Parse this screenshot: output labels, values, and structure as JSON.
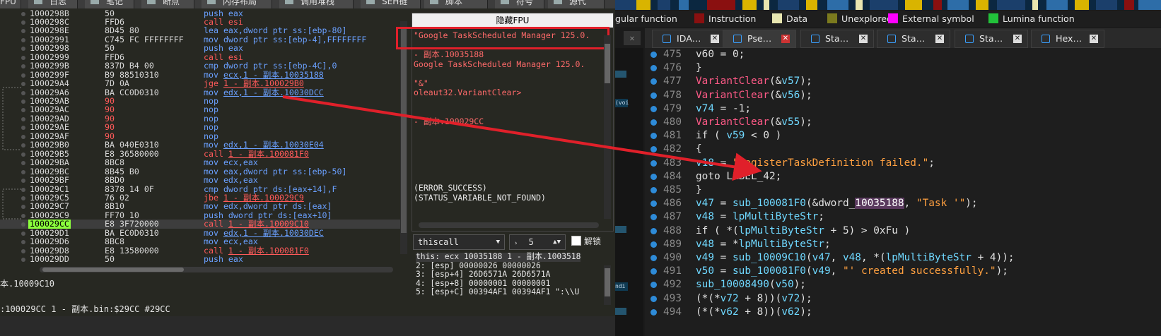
{
  "colors": {
    "accent_red": "#e0202a",
    "legend_instruction": "#8a1010",
    "legend_data": "#e8e6b0",
    "legend_unexplored": "#7b7a1e",
    "legend_external": "#ff00ff",
    "legend_lumina": "#22c23a"
  },
  "debugger": {
    "tabs": [
      {
        "label": "FPU",
        "icon": "cpu-icon"
      },
      {
        "label": "日志",
        "icon": "log-icon"
      },
      {
        "label": "笔记",
        "icon": "notes-icon"
      },
      {
        "label": "断点",
        "icon": "breakpoint-icon"
      },
      {
        "label": "内存布局",
        "icon": "memory-icon"
      },
      {
        "label": "调用堆栈",
        "icon": "callstack-icon"
      },
      {
        "label": "SEH链",
        "icon": "seh-icon"
      },
      {
        "label": "脚本",
        "icon": "script-icon"
      },
      {
        "label": "符号",
        "icon": "symbol-icon"
      },
      {
        "label": "源代",
        "icon": "source-icon"
      }
    ],
    "disasm": [
      {
        "addr": "1000298B",
        "bytes": "50",
        "mn": "push",
        "cls": "c-push",
        "ops": "eax"
      },
      {
        "addr": "1000298C",
        "bytes": "FFD6",
        "mn": "call",
        "cls": "c-call",
        "ops": "esi"
      },
      {
        "addr": "1000298E",
        "bytes": "8D45 80",
        "mn": "lea",
        "cls": "c-lea",
        "ops": "eax,dword ptr ss:[ebp-80]"
      },
      {
        "addr": "10002991",
        "bytes": "C745 FC FFFFFFFF",
        "mn": "mov",
        "cls": "c-mov",
        "ops": "dword ptr ss:[ebp-4],FFFFFFFF"
      },
      {
        "addr": "10002998",
        "bytes": "50",
        "mn": "push",
        "cls": "c-push",
        "ops": "eax"
      },
      {
        "addr": "10002999",
        "bytes": "FFD6",
        "mn": "call",
        "cls": "c-call",
        "ops": "esi"
      },
      {
        "addr": "1000299B",
        "bytes": "837D B4 00",
        "mn": "cmp",
        "cls": "c-cmp",
        "ops": "dword ptr ss:[ebp-4C],0"
      },
      {
        "addr": "1000299F",
        "bytes": "B9 88510310",
        "mn": "mov",
        "cls": "c-mov",
        "ops": "ecx,1 - 副本.10035188"
      },
      {
        "addr": "100029A4",
        "bytes": "7D 0A",
        "mn": "jge",
        "cls": "c-jmp",
        "ops": "1 - 副本.100029B0"
      },
      {
        "addr": "100029A6",
        "bytes": "BA CC0D0310",
        "mn": "mov",
        "cls": "c-mov",
        "ops": "edx,1 - 副本.10030DCC"
      },
      {
        "addr": "100029AB",
        "bytes": "90",
        "mn": "nop",
        "cls": "c-nop",
        "ops": "",
        "b": "nop"
      },
      {
        "addr": "100029AC",
        "bytes": "90",
        "mn": "nop",
        "cls": "c-nop",
        "ops": "",
        "b": "nop"
      },
      {
        "addr": "100029AD",
        "bytes": "90",
        "mn": "nop",
        "cls": "c-nop",
        "ops": "",
        "b": "nop"
      },
      {
        "addr": "100029AE",
        "bytes": "90",
        "mn": "nop",
        "cls": "c-nop",
        "ops": "",
        "b": "nop"
      },
      {
        "addr": "100029AF",
        "bytes": "90",
        "mn": "nop",
        "cls": "c-nop",
        "ops": "",
        "b": "nop"
      },
      {
        "addr": "100029B0",
        "bytes": "BA 040E0310",
        "mn": "mov",
        "cls": "c-mov",
        "ops": "edx,1 - 副本.10030E04"
      },
      {
        "addr": "100029B5",
        "bytes": "E8 36580000",
        "mn": "call",
        "cls": "c-call",
        "ops": "1 - 副本.100081F0"
      },
      {
        "addr": "100029BA",
        "bytes": "8BC8",
        "mn": "mov",
        "cls": "c-mov",
        "ops": "ecx,eax"
      },
      {
        "addr": "100029BC",
        "bytes": "8B45 B0",
        "mn": "mov",
        "cls": "c-mov",
        "ops": "eax,dword ptr ss:[ebp-50]"
      },
      {
        "addr": "100029BF",
        "bytes": "8BD0",
        "mn": "mov",
        "cls": "c-mov",
        "ops": "edx,eax"
      },
      {
        "addr": "100029C1",
        "bytes": "8378 14 0F",
        "mn": "cmp",
        "cls": "c-cmp",
        "ops": "dword ptr ds:[eax+14],F"
      },
      {
        "addr": "100029C5",
        "bytes": "76 02",
        "mn": "jbe",
        "cls": "c-jmp",
        "ops": "1 - 副本.100029C9"
      },
      {
        "addr": "100029C7",
        "bytes": "8B10",
        "mn": "mov",
        "cls": "c-mov",
        "ops": "edx,dword ptr ds:[eax]"
      },
      {
        "addr": "100029C9",
        "bytes": "FF70 10",
        "mn": "push",
        "cls": "c-push",
        "ops": "dword ptr ds:[eax+10]"
      },
      {
        "addr": "100029CC",
        "bytes": "E8 3F720000",
        "mn": "call",
        "cls": "c-call",
        "ops": "1 - 副本.10009C10",
        "cur": true
      },
      {
        "addr": "100029D1",
        "bytes": "BA EC0D0310",
        "mn": "mov",
        "cls": "c-mov",
        "ops": "edx,1 - 副本.10030DEC"
      },
      {
        "addr": "100029D6",
        "bytes": "8BC8",
        "mn": "mov",
        "cls": "c-mov",
        "ops": "ecx,eax"
      },
      {
        "addr": "100029D8",
        "bytes": "E8 13580000",
        "mn": "call",
        "cls": "c-call",
        "ops": "1 - 副本.100081F0"
      },
      {
        "addr": "100029DD",
        "bytes": "50",
        "mn": "push",
        "cls": "c-push",
        "ops": "eax"
      }
    ],
    "status_line1": "本.10009C10",
    "status_line2": ":100029CC 1 - 副本.bin:$29CC #29CC",
    "fpu_title": "隐藏FPU",
    "reg_lines": [
      {
        "t": "\"Google TaskScheduled Manager 125.0.",
        "c": "r"
      },
      {
        "t": "",
        "c": "r"
      },
      {
        "t": " - 副本.10035188",
        "c": "r"
      },
      {
        "t": "Google TaskScheduled Manager 125.0.",
        "c": "r"
      },
      {
        "t": "",
        "c": "r"
      },
      {
        "t": "\"&\"",
        "c": "r"
      },
      {
        "t": "oleaut32.VariantClear>",
        "c": "r"
      },
      {
        "t": "",
        "c": "r"
      },
      {
        "t": "",
        "c": "r"
      },
      {
        "t": " - 副本.100029CC",
        "c": "r"
      },
      {
        "t": "",
        "c": "r"
      },
      {
        "t": "",
        "c": "r"
      },
      {
        "t": "",
        "c": "r"
      },
      {
        "t": "",
        "c": "r"
      },
      {
        "t": "",
        "c": "r"
      },
      {
        "t": "",
        "c": "r"
      },
      {
        "t": "(ERROR_SUCCESS)",
        "c": "w"
      },
      {
        "t": "(STATUS_VARIABLE_NOT_FOUND)",
        "c": "w"
      }
    ],
    "callconv": "thiscall",
    "argcount": "5",
    "unlock_label": "解锁",
    "stack_lines": [
      "this: ecx 10035188 1 - 副本.1003518",
      "2: [esp] 00000026 00000026",
      "3: [esp+4] 26D6571A 26D6571A",
      "4: [esp+8] 00000001 00000001",
      "5: [esp+C] 00394AF1 00394AF1 \":\\\\U"
    ]
  },
  "ida": {
    "legend": [
      {
        "label": "gular function",
        "swatch": ""
      },
      {
        "label": "Instruction",
        "swatch": "#8a1010"
      },
      {
        "label": "Data",
        "swatch": "#e8e6b0"
      },
      {
        "label": "Unexplored",
        "swatch": "#7b7a1e"
      },
      {
        "label": "External symbol",
        "swatch": "#ff00ff"
      },
      {
        "label": "Lumina function",
        "swatch": "#22c23a"
      }
    ],
    "tabs": [
      {
        "label": "IDA…",
        "close": "light"
      },
      {
        "label": "Pse…",
        "close": "red",
        "active": true
      },
      {
        "label": "Sta…",
        "close": "light"
      },
      {
        "label": "Sta…",
        "close": "light"
      },
      {
        "label": "Sta…",
        "close": "light"
      },
      {
        "label": "Hex…",
        "close": "light"
      }
    ],
    "strip_chips": [
      "(voi",
      "ndi"
    ],
    "lines": [
      {
        "n": "475",
        "s": [
          [
            "  v60 = 0;",
            ""
          ]
        ]
      },
      {
        "n": "476",
        "s": [
          [
            "}",
            ""
          ]
        ]
      },
      {
        "n": "477",
        "s": [
          [
            "VariantClear",
            "k-fn"
          ],
          [
            "(&",
            ""
          ],
          [
            "v57",
            "k-var"
          ],
          [
            ");",
            ""
          ]
        ]
      },
      {
        "n": "478",
        "s": [
          [
            "VariantClear",
            "k-fn"
          ],
          [
            "(&",
            ""
          ],
          [
            "v56",
            "k-var"
          ],
          [
            ");",
            ""
          ]
        ]
      },
      {
        "n": "479",
        "s": [
          [
            "v74",
            "k-var"
          ],
          [
            " = -1;",
            ""
          ]
        ]
      },
      {
        "n": "480",
        "s": [
          [
            "VariantClear",
            "k-fn"
          ],
          [
            "(&",
            ""
          ],
          [
            "v55",
            "k-var"
          ],
          [
            ");",
            ""
          ]
        ]
      },
      {
        "n": "481",
        "s": [
          [
            "if ( ",
            ""
          ],
          [
            "v59",
            "k-var"
          ],
          [
            " < 0 )",
            ""
          ]
        ]
      },
      {
        "n": "482",
        "s": [
          [
            "{",
            ""
          ]
        ]
      },
      {
        "n": "483",
        "s": [
          [
            "  v18",
            "k-var"
          ],
          [
            " = ",
            ""
          ],
          [
            "\"RegisterTaskDefinition failed.\"",
            "k-str"
          ],
          [
            ";",
            ""
          ]
        ]
      },
      {
        "n": "484",
        "s": [
          [
            "  goto LABEL_42;",
            ""
          ]
        ]
      },
      {
        "n": "485",
        "s": [
          [
            "}",
            ""
          ]
        ]
      },
      {
        "n": "486",
        "s": [
          [
            "v47",
            "k-var"
          ],
          [
            " = ",
            ""
          ],
          [
            "sub_100081F0",
            "k-var"
          ],
          [
            "(&dword_",
            ""
          ],
          [
            "10035188",
            "k-hl"
          ],
          [
            ", ",
            ""
          ],
          [
            "\"Task '\"",
            "k-str"
          ],
          [
            ");",
            ""
          ]
        ]
      },
      {
        "n": "487",
        "s": [
          [
            "v48",
            "k-var"
          ],
          [
            " = ",
            ""
          ],
          [
            "lpMultiByteStr",
            "k-var"
          ],
          [
            ";",
            ""
          ]
        ]
      },
      {
        "n": "488",
        "s": [
          [
            "if ( *(",
            ""
          ],
          [
            "lpMultiByteStr",
            "k-var"
          ],
          [
            " + 5) > 0xFu )",
            ""
          ]
        ]
      },
      {
        "n": "489",
        "s": [
          [
            "  v48",
            "k-var"
          ],
          [
            " = *",
            ""
          ],
          [
            "lpMultiByteStr",
            "k-var"
          ],
          [
            ";",
            ""
          ]
        ]
      },
      {
        "n": "490",
        "s": [
          [
            "v49",
            "k-var"
          ],
          [
            " = ",
            ""
          ],
          [
            "sub_10009C10",
            "k-var"
          ],
          [
            "(",
            ""
          ],
          [
            "v47",
            "k-var"
          ],
          [
            ", ",
            ""
          ],
          [
            "v48",
            "k-var"
          ],
          [
            ", *(",
            ""
          ],
          [
            "lpMultiByteStr",
            "k-var"
          ],
          [
            " + 4));",
            ""
          ]
        ]
      },
      {
        "n": "491",
        "s": [
          [
            "v50",
            "k-var"
          ],
          [
            " = ",
            ""
          ],
          [
            "sub_100081F0",
            "k-var"
          ],
          [
            "(",
            ""
          ],
          [
            "v49",
            "k-var"
          ],
          [
            ", ",
            ""
          ],
          [
            "\"' created successfully.\"",
            "k-str"
          ],
          [
            ");",
            ""
          ]
        ]
      },
      {
        "n": "492",
        "s": [
          [
            "sub_10008490",
            "k-var"
          ],
          [
            "(",
            ""
          ],
          [
            "v50",
            "k-var"
          ],
          [
            ");",
            ""
          ]
        ]
      },
      {
        "n": "493",
        "s": [
          [
            "(*(*",
            ""
          ],
          [
            "v72",
            "k-var"
          ],
          [
            " + 8))(",
            ""
          ],
          [
            "v72",
            "k-var"
          ],
          [
            ");",
            ""
          ]
        ]
      },
      {
        "n": "494",
        "s": [
          [
            "(*(*",
            ""
          ],
          [
            "v62",
            "k-var"
          ],
          [
            " + 8))(",
            ""
          ],
          [
            "v62",
            "k-var"
          ],
          [
            ");",
            ""
          ]
        ]
      }
    ]
  }
}
